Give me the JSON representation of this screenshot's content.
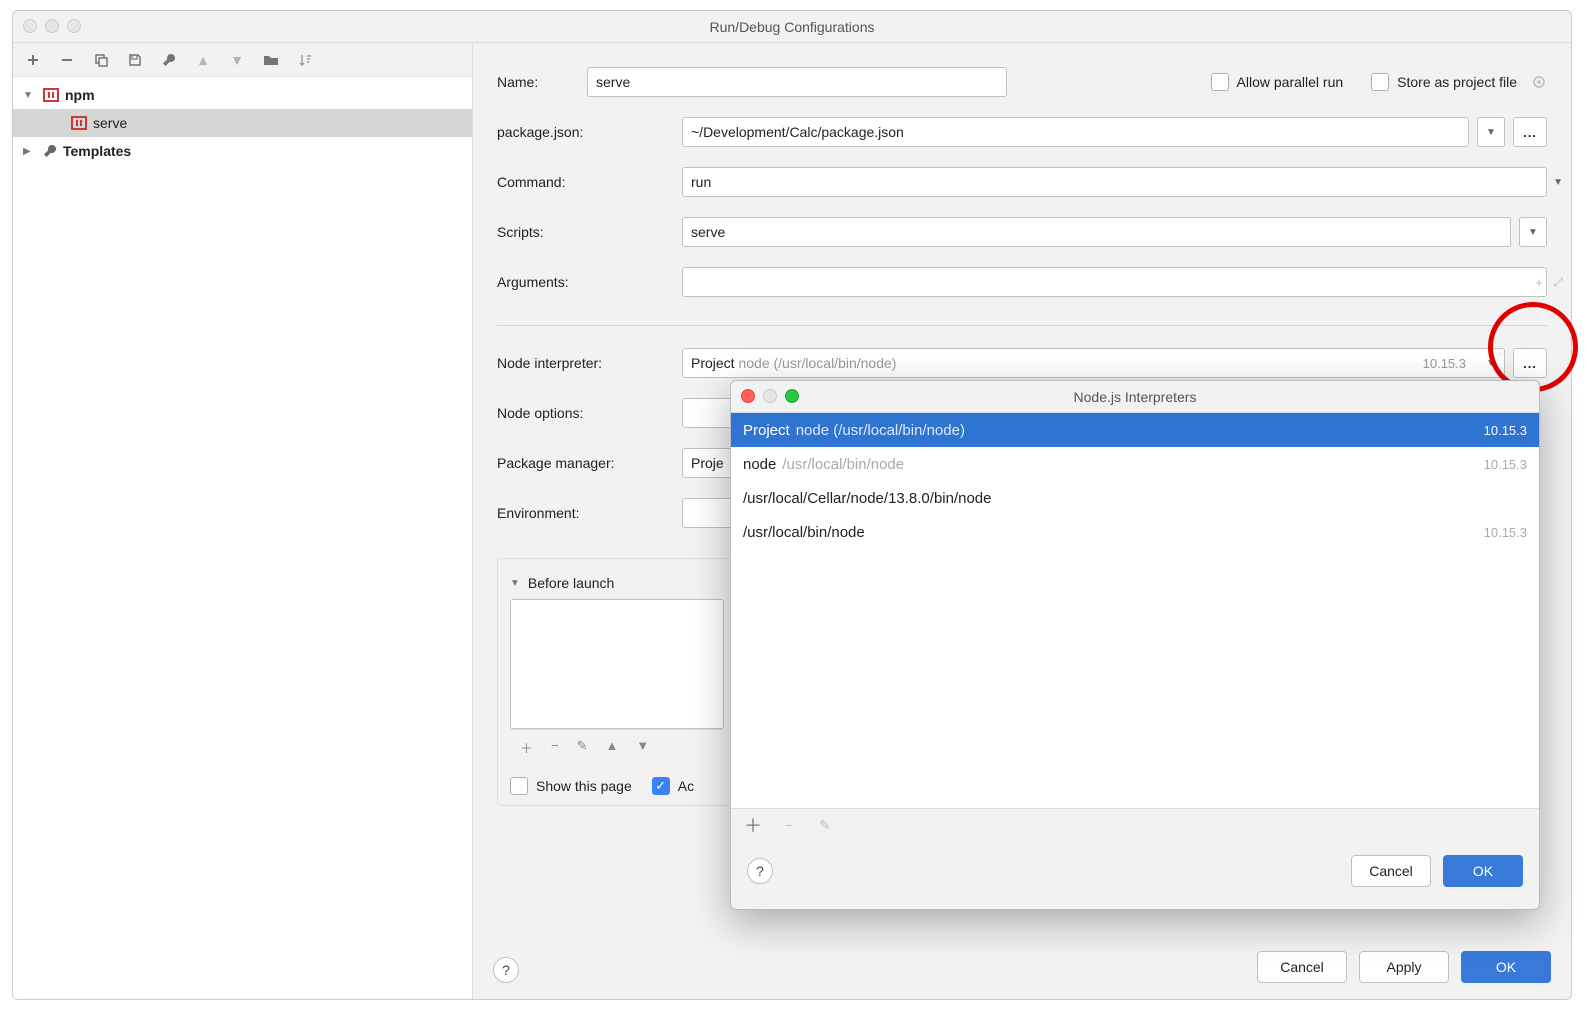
{
  "window": {
    "title": "Run/Debug Configurations"
  },
  "tree": {
    "npm": {
      "label": "npm",
      "child": "serve"
    },
    "templates": {
      "label": "Templates"
    }
  },
  "form": {
    "name_label": "Name:",
    "name_value": "serve",
    "allow_parallel": "Allow parallel run",
    "store_project": "Store as project file",
    "package_json_label": "package.json:",
    "package_json_value": "~/Development/Calc/package.json",
    "command_label": "Command:",
    "command_value": "run",
    "scripts_label": "Scripts:",
    "scripts_value": "serve",
    "arguments_label": "Arguments:",
    "node_interp_label": "Node interpreter:",
    "node_interp_prefix": "Project",
    "node_interp_path": "node (/usr/local/bin/node)",
    "node_interp_version": "10.15.3",
    "node_options_label": "Node options:",
    "pkg_manager_label": "Package manager:",
    "pkg_manager_prefix": "Proje",
    "env_label": "Environment:",
    "before_launch": "Before launch",
    "show_page": "Show this page",
    "activate": "Ac"
  },
  "footer": {
    "cancel": "Cancel",
    "apply": "Apply",
    "ok": "OK"
  },
  "sub": {
    "title": "Node.js Interpreters",
    "rows": [
      {
        "label": "Project",
        "path": "node (/usr/local/bin/node)",
        "ver": "10.15.3",
        "sel": true
      },
      {
        "label": "node",
        "path": "/usr/local/bin/node",
        "ver": "10.15.3",
        "gray": true
      },
      {
        "label": "/usr/local/Cellar/node/13.8.0/bin/node",
        "path": "",
        "ver": ""
      },
      {
        "label": "/usr/local/bin/node",
        "path": "",
        "ver": "10.15.3",
        "gray": true
      }
    ],
    "cancel": "Cancel",
    "ok": "OK"
  }
}
